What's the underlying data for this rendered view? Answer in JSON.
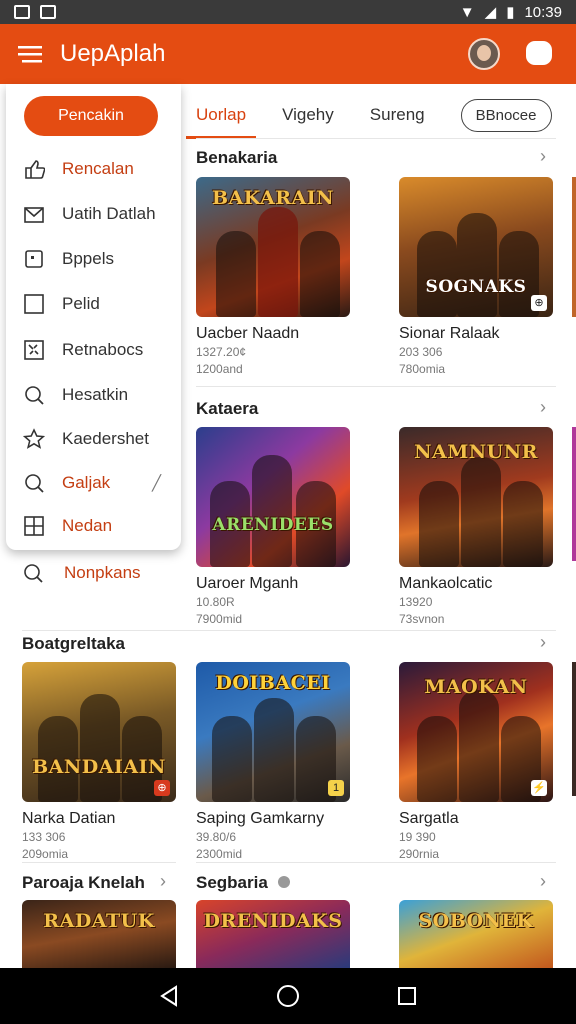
{
  "status_bar": {
    "time": "10:39"
  },
  "app_bar": {
    "title": "UepAplah"
  },
  "tabs": [
    {
      "label": "Uorlap",
      "active": true
    },
    {
      "label": "Vigehy",
      "active": false
    },
    {
      "label": "Sureng",
      "active": false
    },
    {
      "label": "BBnocee",
      "active": false
    }
  ],
  "drawer": {
    "primary_button": "Pencakin",
    "items": [
      {
        "label": "Rencalan",
        "icon": "thumbs-up-icon",
        "accent": true
      },
      {
        "label": "Uatih Datlah",
        "icon": "envelope-check-icon",
        "accent": false
      },
      {
        "label": "Bppels",
        "icon": "note-icon",
        "accent": false
      },
      {
        "label": "Pelid",
        "icon": "square-icon",
        "accent": false
      },
      {
        "label": "Retnabocs",
        "icon": "grid-icon",
        "accent": false
      },
      {
        "label": "Hesatkin",
        "icon": "search-icon",
        "accent": false
      },
      {
        "label": "Kaedershet",
        "icon": "star-icon",
        "accent": false
      },
      {
        "label": "Galjak",
        "icon": "search-icon",
        "accent": true
      },
      {
        "label": "Nedan",
        "icon": "grid-icon",
        "accent": true
      }
    ],
    "outside_item": "Nonpkans"
  },
  "sections": [
    {
      "title": "Benakaria",
      "cards": [
        {
          "logo": "BAKARAIN",
          "name": "Uacber Naadn",
          "meta1": "1327.20¢",
          "meta2": "1200and",
          "badge": ""
        },
        {
          "logo": "SOGNAKS",
          "name": "Sionar Ralaak",
          "meta1": "203 306",
          "meta2": "780omia",
          "badge": "⊕"
        }
      ]
    },
    {
      "title": "Kataera",
      "cards": [
        {
          "logo": "ARENIDEES",
          "name": "Uaroer Mganh",
          "meta1": "10.80R",
          "meta2": "7900mid",
          "badge": ""
        },
        {
          "logo": "NAMNUNR",
          "name": "Mankaolcatic",
          "meta1": "13920",
          "meta2": "73svnon",
          "badge": ""
        }
      ]
    },
    {
      "title": "Boatgreltaka",
      "cards": [
        {
          "logo": "BANDAIAIN",
          "name": "Narka Datian",
          "meta1": "133 306",
          "meta2": "209omia",
          "badge": "⊕"
        },
        {
          "logo": "DOIBACEI",
          "name": "Saping Gamkarny",
          "meta1": "39.80/6",
          "meta2": "2300mid",
          "badge": "1"
        },
        {
          "logo": "MAOKAN",
          "name": "Sargatla",
          "meta1": "19 390",
          "meta2": "290rnia",
          "badge": "⚡"
        }
      ]
    },
    {
      "title_left": "Paroaja Knelah",
      "title_right": "Segbaria",
      "cards": [
        {
          "logo": "RADATUK",
          "badge": ""
        },
        {
          "logo": "DRENIDAKS",
          "badge": ""
        },
        {
          "logo": "SOBONEK",
          "badge": ""
        }
      ]
    }
  ]
}
